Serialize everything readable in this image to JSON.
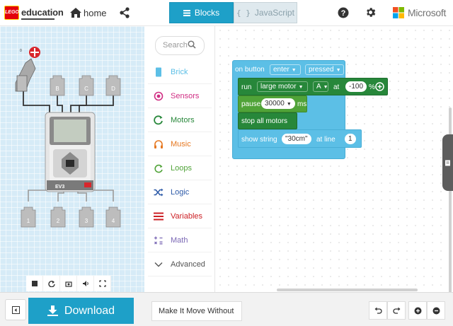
{
  "header": {
    "brand": "education",
    "logo_text": "LEGO",
    "home_label": "home",
    "tabs": [
      {
        "label": "Blocks",
        "active": true
      },
      {
        "label": "JavaScript",
        "active": false
      }
    ],
    "vendor": "Microsoft"
  },
  "simulator": {
    "input_ports": [
      "B",
      "C",
      "D"
    ],
    "output_ports": [
      "1",
      "2",
      "3",
      "4"
    ],
    "brick_label": "EV3",
    "controls": [
      "stop-icon",
      "restart-icon",
      "screenshot-icon",
      "sound-icon",
      "fullscreen-icon"
    ]
  },
  "toolbox": {
    "search_placeholder": "Search",
    "categories": [
      {
        "label": "Brick",
        "color": "#5cbfe6",
        "icon": "brick-icon"
      },
      {
        "label": "Sensors",
        "color": "#d02e83",
        "icon": "sensor-icon"
      },
      {
        "label": "Motors",
        "color": "#27873a",
        "icon": "motor-icon"
      },
      {
        "label": "Music",
        "color": "#e67821",
        "icon": "headphones-icon"
      },
      {
        "label": "Loops",
        "color": "#50a338",
        "icon": "loop-icon"
      },
      {
        "label": "Logic",
        "color": "#2d5aa8",
        "icon": "shuffle-icon"
      },
      {
        "label": "Variables",
        "color": "#cc1f24",
        "icon": "list-icon"
      },
      {
        "label": "Math",
        "color": "#7b68b5",
        "icon": "calculator-icon"
      },
      {
        "label": "Advanced",
        "color": "#555555",
        "icon": "chevron-down-icon"
      }
    ]
  },
  "blocks": {
    "event": {
      "prefix": "on button",
      "button": "enter",
      "action": "pressed"
    },
    "run_motor": {
      "prefix": "run",
      "motor": "large motor",
      "port": "A",
      "at": "at",
      "speed": "-100",
      "unit": "%"
    },
    "pause": {
      "prefix": "pause",
      "value": "30000",
      "unit": "ms"
    },
    "stop": {
      "label": "stop all motors"
    },
    "show_string": {
      "prefix": "show string",
      "text": "\"30cm\"",
      "at_line": "at line",
      "line": "1"
    }
  },
  "bottombar": {
    "download_label": "Download",
    "project_name": "Make It Move Without"
  },
  "colors": {
    "accent": "#1ea0c8",
    "brick_block": "#5cbfe6",
    "motor_block": "#27873a",
    "loop_block": "#50a338"
  }
}
